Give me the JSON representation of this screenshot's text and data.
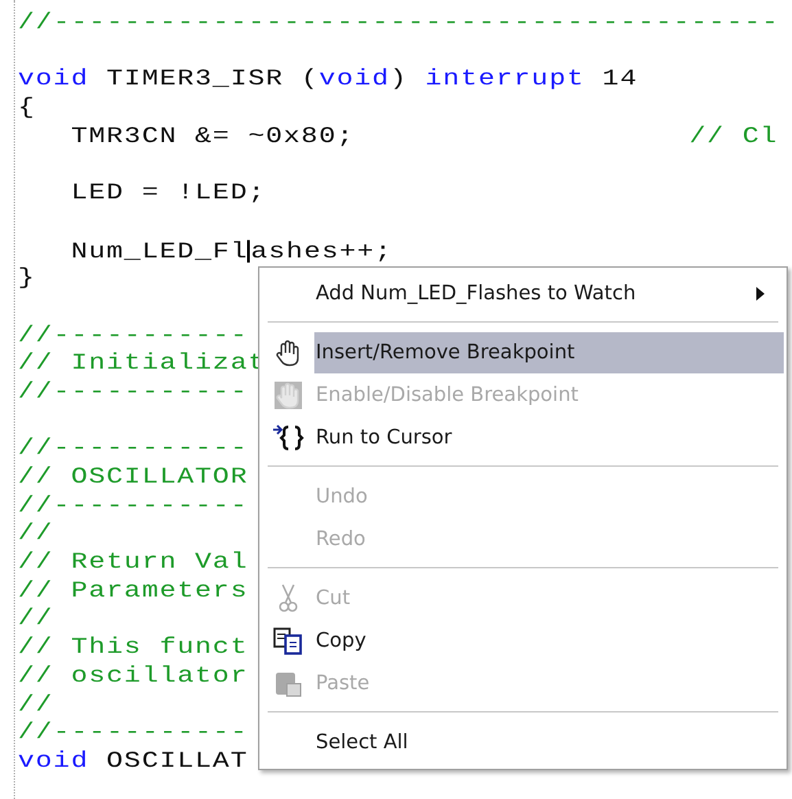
{
  "editor": {
    "lines": [
      {
        "kind": "code",
        "segments": [
          {
            "kind": "comment",
            "text": "//-----------------------------------------"
          }
        ]
      },
      {
        "kind": "blank"
      },
      {
        "kind": "code",
        "segments": [
          {
            "kind": "keyword",
            "text": "void"
          },
          {
            "kind": "plain",
            "text": " TIMER3_ISR ("
          },
          {
            "kind": "keyword",
            "text": "void"
          },
          {
            "kind": "plain",
            "text": ") "
          },
          {
            "kind": "keyword",
            "text": "interrupt"
          },
          {
            "kind": "plain",
            "text": " 14"
          }
        ]
      },
      {
        "kind": "code",
        "segments": [
          {
            "kind": "plain",
            "text": "{"
          }
        ]
      },
      {
        "kind": "code",
        "segments": [
          {
            "kind": "plain",
            "text": "   TMR3CN &= ~0x80;"
          },
          {
            "kind": "comment",
            "text": "// Cl"
          }
        ]
      },
      {
        "kind": "blank"
      },
      {
        "kind": "code",
        "segments": [
          {
            "kind": "plain",
            "text": "   LED = !LED;"
          }
        ]
      },
      {
        "kind": "blank"
      },
      {
        "kind": "code",
        "segments": [
          {
            "kind": "plain",
            "text": "   Num_LED_Fl",
            "caret_after": true
          },
          {
            "kind": "plain",
            "text": "ashes++;"
          }
        ]
      },
      {
        "kind": "code",
        "segments": [
          {
            "kind": "plain",
            "text": "}"
          }
        ]
      },
      {
        "kind": "blank"
      },
      {
        "kind": "code",
        "segments": [
          {
            "kind": "comment",
            "text": "//-----------"
          }
        ]
      },
      {
        "kind": "code",
        "segments": [
          {
            "kind": "comment",
            "text": "// Initializat"
          }
        ]
      },
      {
        "kind": "code",
        "segments": [
          {
            "kind": "comment",
            "text": "//-----------"
          }
        ]
      },
      {
        "kind": "blank"
      },
      {
        "kind": "code",
        "segments": [
          {
            "kind": "comment",
            "text": "//-----------"
          }
        ]
      },
      {
        "kind": "code",
        "segments": [
          {
            "kind": "comment",
            "text": "// OSCILLATOR"
          }
        ]
      },
      {
        "kind": "code",
        "segments": [
          {
            "kind": "comment",
            "text": "//-----------"
          }
        ]
      },
      {
        "kind": "code",
        "segments": [
          {
            "kind": "comment",
            "text": "//"
          }
        ]
      },
      {
        "kind": "code",
        "segments": [
          {
            "kind": "comment",
            "text": "// Return Val"
          }
        ]
      },
      {
        "kind": "code",
        "segments": [
          {
            "kind": "comment",
            "text": "// Parameters"
          }
        ]
      },
      {
        "kind": "code",
        "segments": [
          {
            "kind": "comment",
            "text": "//"
          }
        ]
      },
      {
        "kind": "code",
        "segments": [
          {
            "kind": "comment",
            "text": "// This funct"
          }
        ]
      },
      {
        "kind": "code",
        "segments": [
          {
            "kind": "comment",
            "text": "// oscillator"
          }
        ]
      },
      {
        "kind": "code",
        "segments": [
          {
            "kind": "comment",
            "text": "//"
          }
        ]
      },
      {
        "kind": "code",
        "segments": [
          {
            "kind": "comment",
            "text": "//-----------"
          }
        ]
      },
      {
        "kind": "code",
        "segments": [
          {
            "kind": "keyword",
            "text": "void"
          },
          {
            "kind": "plain",
            "text": " OSCILLAT"
          }
        ]
      }
    ]
  },
  "context_menu": {
    "items": [
      {
        "kind": "submenu",
        "label": "Add Num_LED_Flashes to Watch",
        "disabled": false,
        "selected": false
      },
      {
        "kind": "separator"
      },
      {
        "kind": "item",
        "label": "Insert/Remove Breakpoint",
        "disabled": false,
        "selected": true
      },
      {
        "kind": "item",
        "label": "Enable/Disable Breakpoint",
        "disabled": true,
        "selected": false
      },
      {
        "kind": "item",
        "label": "Run to Cursor",
        "disabled": false,
        "selected": false
      },
      {
        "kind": "separator"
      },
      {
        "kind": "item",
        "label": "Undo",
        "disabled": true,
        "selected": false
      },
      {
        "kind": "item",
        "label": "Redo",
        "disabled": true,
        "selected": false
      },
      {
        "kind": "separator"
      },
      {
        "kind": "item",
        "label": "Cut",
        "disabled": true,
        "selected": false
      },
      {
        "kind": "item",
        "label": "Copy",
        "disabled": false,
        "selected": false
      },
      {
        "kind": "item",
        "label": "Paste",
        "disabled": true,
        "selected": false
      },
      {
        "kind": "separator"
      },
      {
        "kind": "item",
        "label": "Select All",
        "disabled": false,
        "selected": false
      }
    ]
  }
}
